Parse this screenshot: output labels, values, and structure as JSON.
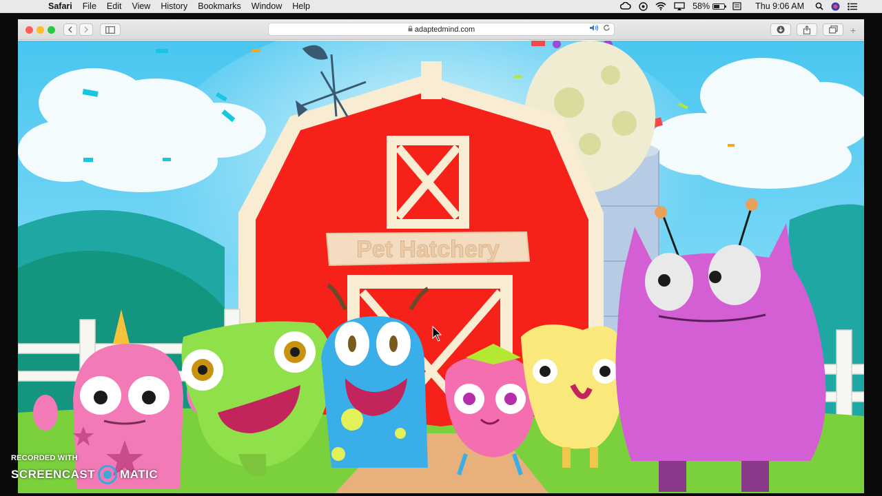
{
  "menubar": {
    "apple": "",
    "items": [
      "Safari",
      "File",
      "Edit",
      "View",
      "History",
      "Bookmarks",
      "Window",
      "Help"
    ],
    "battery_percent": "58%",
    "battery_level": 0.58,
    "clock": "Thu 9:06 AM"
  },
  "browser": {
    "url": "adaptedmind.com"
  },
  "scene": {
    "barn_sign": "Pet Hatchery"
  },
  "watermark": {
    "line1": "RECORDED WITH",
    "word1": "SCREENCAST",
    "word2": "MATIC"
  },
  "colors": {
    "sky": "#5ed1f3",
    "barn_red": "#f6221a",
    "barn_trim": "#f8ecd2",
    "grass": "#7bd13c",
    "pink_monster": "#f27ab7",
    "green_monster": "#8fe04a",
    "blue_monster": "#3aaee8",
    "purple_monster": "#d45fd4"
  }
}
